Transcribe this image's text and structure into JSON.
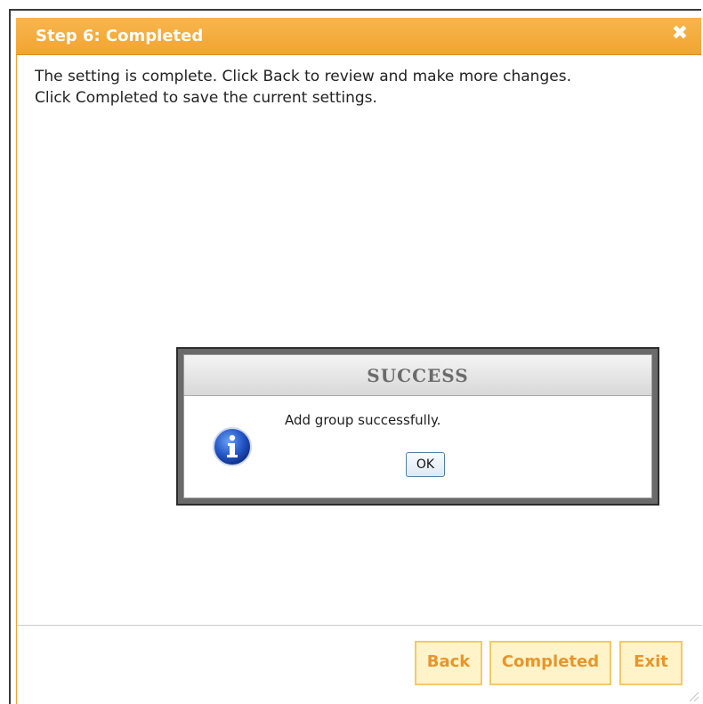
{
  "dialog": {
    "title": "Step 6: Completed",
    "close_icon": "close-icon",
    "instructions": [
      "The setting is complete. Click Back to review and make more changes.",
      "Click Completed to save the current settings."
    ],
    "buttons": {
      "back": "Back",
      "completed": "Completed",
      "exit": "Exit"
    },
    "colors": {
      "titlebar": "#f2a431",
      "button_text": "#e8952b",
      "button_bg": "#fff4c9"
    }
  },
  "modal": {
    "title": "SUCCESS",
    "message": "Add group successfully.",
    "icon": "info-icon",
    "ok_label": "OK"
  }
}
